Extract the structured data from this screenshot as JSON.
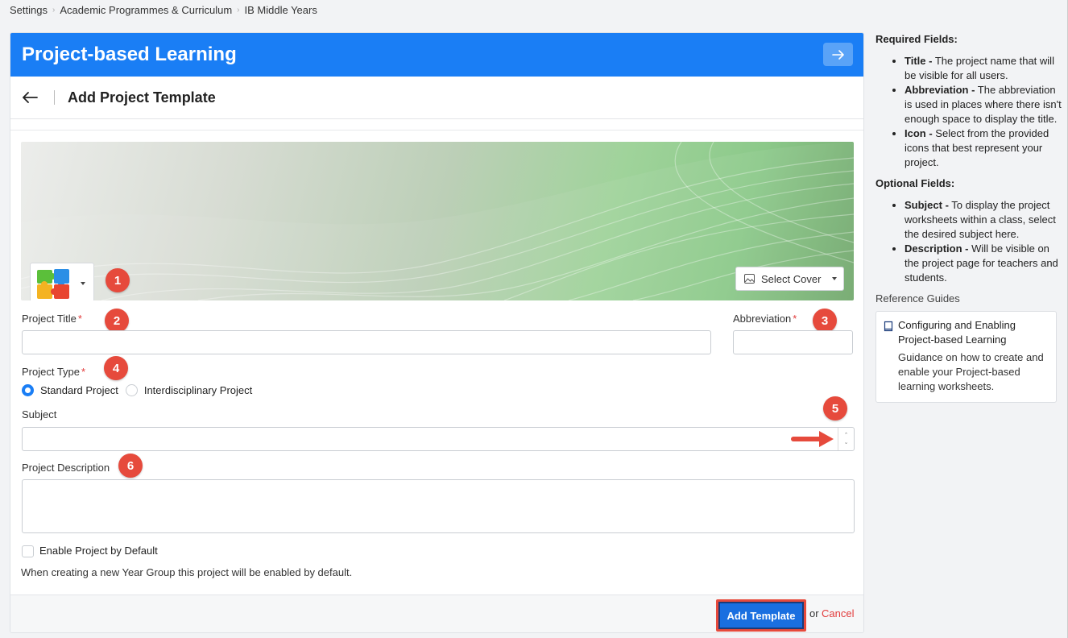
{
  "breadcrumb": [
    "Settings",
    "Academic Programmes & Curriculum",
    "IB Middle Years"
  ],
  "header": {
    "title": "Project-based Learning",
    "expand_icon": "arrow-right-icon"
  },
  "subheader": {
    "title": "Add Project Template",
    "back_icon": "arrow-left-icon"
  },
  "cover": {
    "select_cover_label": "Select Cover",
    "project_icon": "puzzle-icon"
  },
  "badges": [
    "1",
    "2",
    "3",
    "4",
    "5",
    "6"
  ],
  "form": {
    "project_title_label": "Project Title",
    "project_title_value": "",
    "abbreviation_label": "Abbreviation",
    "abbreviation_value": "",
    "required_marker": "*",
    "project_type_label": "Project Type",
    "project_type_options": [
      "Standard Project",
      "Interdisciplinary Project"
    ],
    "project_type_selected": "Standard Project",
    "subject_label": "Subject",
    "subject_value": "",
    "description_label": "Project Description",
    "description_value": "",
    "enable_default_label": "Enable Project by Default",
    "enable_default_checked": false,
    "enable_default_hint": "When creating a new Year Group this project will be enabled by default."
  },
  "footer": {
    "add_label": "Add Template",
    "or_text": "or",
    "cancel_label": "Cancel"
  },
  "side_panel": {
    "required_title": "Required Fields:",
    "required_items": [
      {
        "term": "Title -",
        "desc": "The project name that will be visible for all users."
      },
      {
        "term": "Abbreviation -",
        "desc": "The abbreviation is used in places where there isn't enough space to display the title."
      },
      {
        "term": "Icon -",
        "desc": "Select from the provided icons that best represent your project."
      }
    ],
    "optional_title": "Optional Fields:",
    "optional_items": [
      {
        "term": "Subject -",
        "desc": "To display the project worksheets within a class, select the desired subject here."
      },
      {
        "term": "Description -",
        "desc": "Will be visible on the project page for teachers and students."
      }
    ],
    "reference_title": "Reference Guides",
    "guide": {
      "title": "Configuring and Enabling Project-based Learning",
      "desc": "Guidance on how to create and enable your Project-based learning worksheets."
    }
  },
  "colors": {
    "primary": "#1a7ef5",
    "badge": "#e64a3c",
    "cancel": "#e23b3b"
  }
}
